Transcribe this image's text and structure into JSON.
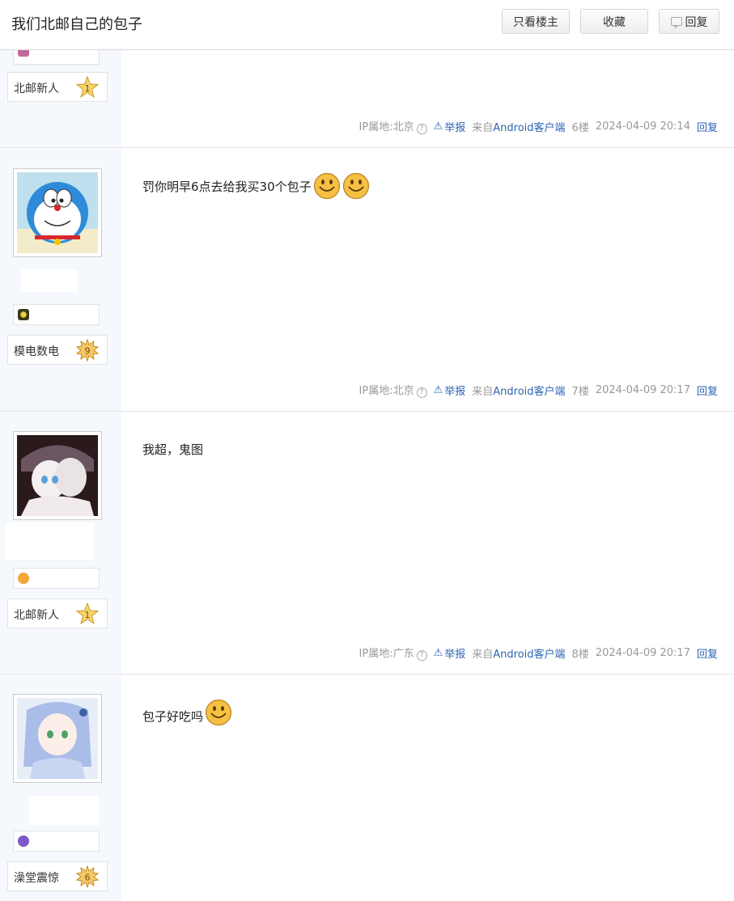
{
  "header": {
    "title": "我们北邮自己的包子",
    "only_op_label": "只看楼主",
    "favorite_label": "收藏",
    "reply_label": "回复"
  },
  "meta_labels": {
    "report": "举报",
    "from_prefix": "来自",
    "client": "Android客户端",
    "reply": "回复"
  },
  "posts": [
    {
      "level_name": "北邮新人",
      "level": "1",
      "ip": "IP属地:北京",
      "floor": "6楼",
      "time": "2024-04-09 20:14"
    },
    {
      "content": "罚你明早6点去给我买30个包子",
      "level_name": "模电数电",
      "level": "9",
      "ip": "IP属地:北京",
      "floor": "7楼",
      "time": "2024-04-09 20:17",
      "emoji_count": 2
    },
    {
      "content": "我超，鬼图",
      "level_name": "北邮新人",
      "level": "1",
      "ip": "IP属地:广东",
      "floor": "8楼",
      "time": "2024-04-09 20:17",
      "emoji_count": 0
    },
    {
      "content": "包子好吃吗",
      "level_name": "澡堂震惊",
      "level": "6",
      "emoji_count": 1
    }
  ],
  "colors": {
    "link_blue": "#2d64b3",
    "sidebar_bg": "#f5f8fc",
    "meta_gray": "#999999"
  }
}
